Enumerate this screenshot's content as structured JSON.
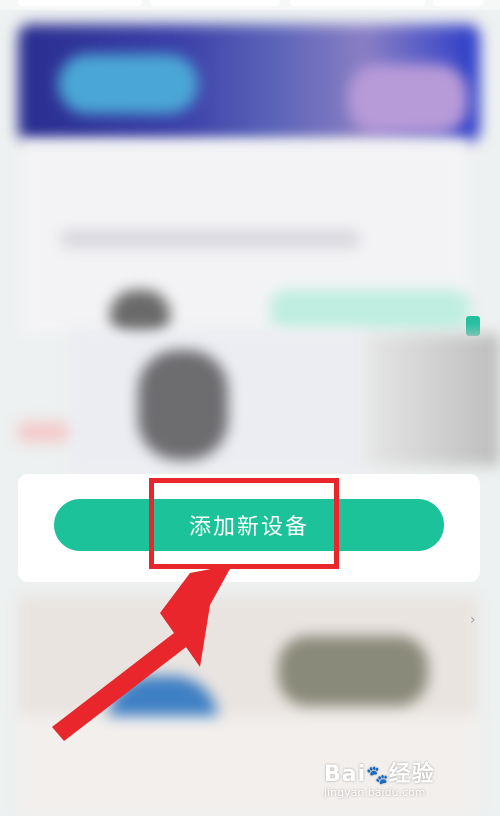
{
  "action": {
    "add_device_label": "添加新设备"
  },
  "watermark": {
    "brand": "Bai",
    "brand_suffix": "经验",
    "url": "jingyan.baidu.com"
  },
  "colors": {
    "button": "#1cc39a",
    "highlight": "#e8262b",
    "arrow": "#e8262b"
  },
  "icons": {
    "chevron": "chevron-right-icon",
    "paw": "paw-icon"
  }
}
